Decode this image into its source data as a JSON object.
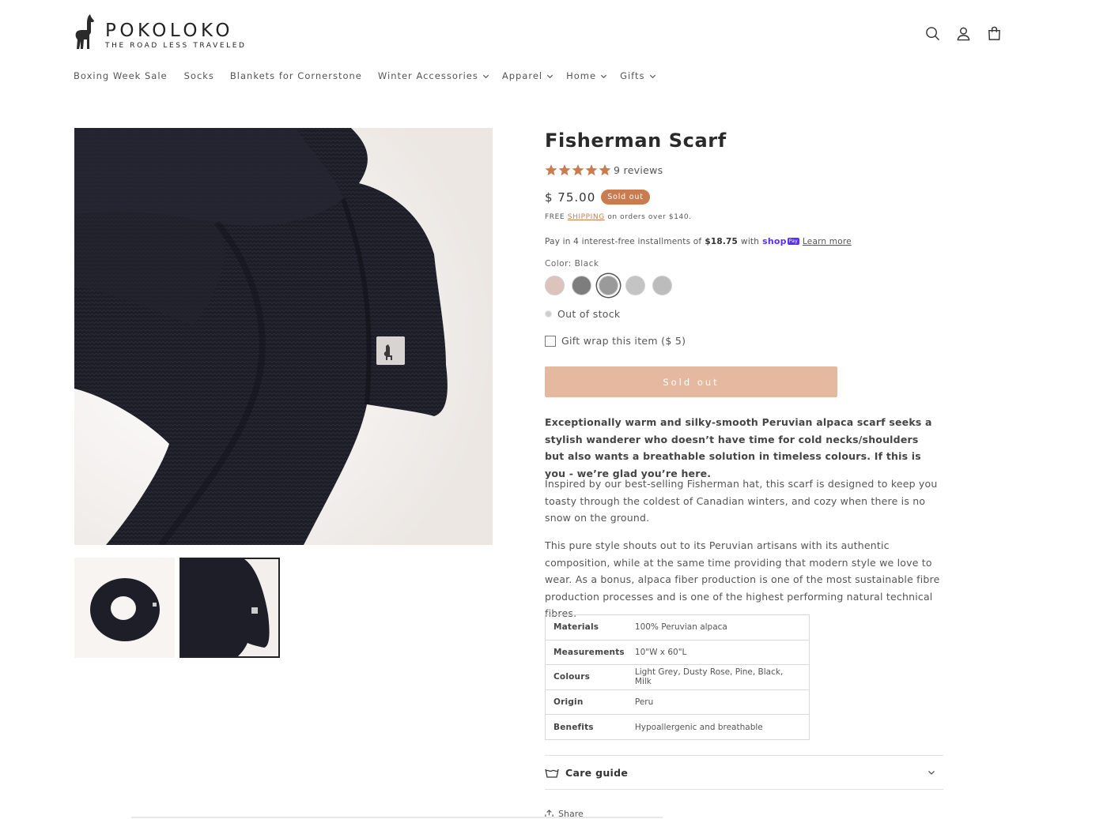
{
  "brand": {
    "name": "POKOLOKO",
    "tagline": "THE ROAD LESS TRAVELED"
  },
  "header_icons": [
    "search-icon",
    "account-icon",
    "cart-icon"
  ],
  "nav": [
    {
      "label": "Boxing Week Sale",
      "dropdown": false
    },
    {
      "label": "Socks",
      "dropdown": false
    },
    {
      "label": "Blankets for Cornerstone",
      "dropdown": false
    },
    {
      "label": "Winter Accessories",
      "dropdown": true
    },
    {
      "label": "Apparel",
      "dropdown": true
    },
    {
      "label": "Home",
      "dropdown": true
    },
    {
      "label": "Gifts",
      "dropdown": true
    }
  ],
  "product": {
    "title": "Fisherman Scarf",
    "rating": 5,
    "reviews_label": "9 reviews",
    "price": "$ 75.00",
    "badge": "Sold out",
    "shipping": {
      "prefix": "FREE",
      "link": "SHIPPING",
      "suffix": "on orders over $140."
    },
    "installments": {
      "prefix": "Pay in 4 interest-free installments of",
      "amount": "$18.75",
      "with": "with",
      "shop": "shop",
      "pay": "Pay",
      "learn_more": "Learn more"
    },
    "color_label": "Color: Black",
    "swatches": [
      {
        "name": "Dusty Rose",
        "color": "#dcc3bb",
        "selected": false
      },
      {
        "name": "Pine",
        "color": "#7d7d7d",
        "selected": false
      },
      {
        "name": "Black",
        "color": "#9a9a9a",
        "selected": true
      },
      {
        "name": "Light Grey",
        "color": "#c4c4c4",
        "selected": false
      },
      {
        "name": "Milk",
        "color": "#bcbcbc",
        "selected": false
      }
    ],
    "stock_status": "Out of stock",
    "gift_wrap": "Gift wrap this item ($ 5)",
    "button": "Sold out",
    "description_bold": "Exceptionally warm and silky-smooth Peruvian alpaca scarf seeks a stylish wanderer who doesn’t have time for cold necks/shoulders but also wants a breathable solution in timeless colours. If this is you - we’re glad you’re here.",
    "description_1": "Inspired by our best-selling Fisherman hat, this scarf is designed to keep you toasty through the coldest of Canadian winters, and cozy when there is no snow on the ground.",
    "description_2": "This pure style shouts out to its Peruvian artisans with its authentic composition, while at the same time providing that modern style we love to wear. As a bonus, alpaca fiber production is one of the most sustainable fibre production processes and is one of the highest performing natural technical fibres.",
    "specs": [
      {
        "key": "Materials",
        "value": "100% Peruvian alpaca"
      },
      {
        "key": "Measurements",
        "value": "10\"W x 60\"L"
      },
      {
        "key": "Colours",
        "value": "Light Grey, Dusty Rose, Pine, Black, Milk"
      },
      {
        "key": "Origin",
        "value": "Peru"
      },
      {
        "key": "Benefits",
        "value": "Hypoallergenic and breathable"
      }
    ],
    "care_guide": "Care guide",
    "share": "Share"
  },
  "colors": {
    "accent": "#c97c4f",
    "button_bg": "#e5b8a0",
    "image_bg": "#f8f4f1",
    "scarf": "#1d1e28"
  }
}
